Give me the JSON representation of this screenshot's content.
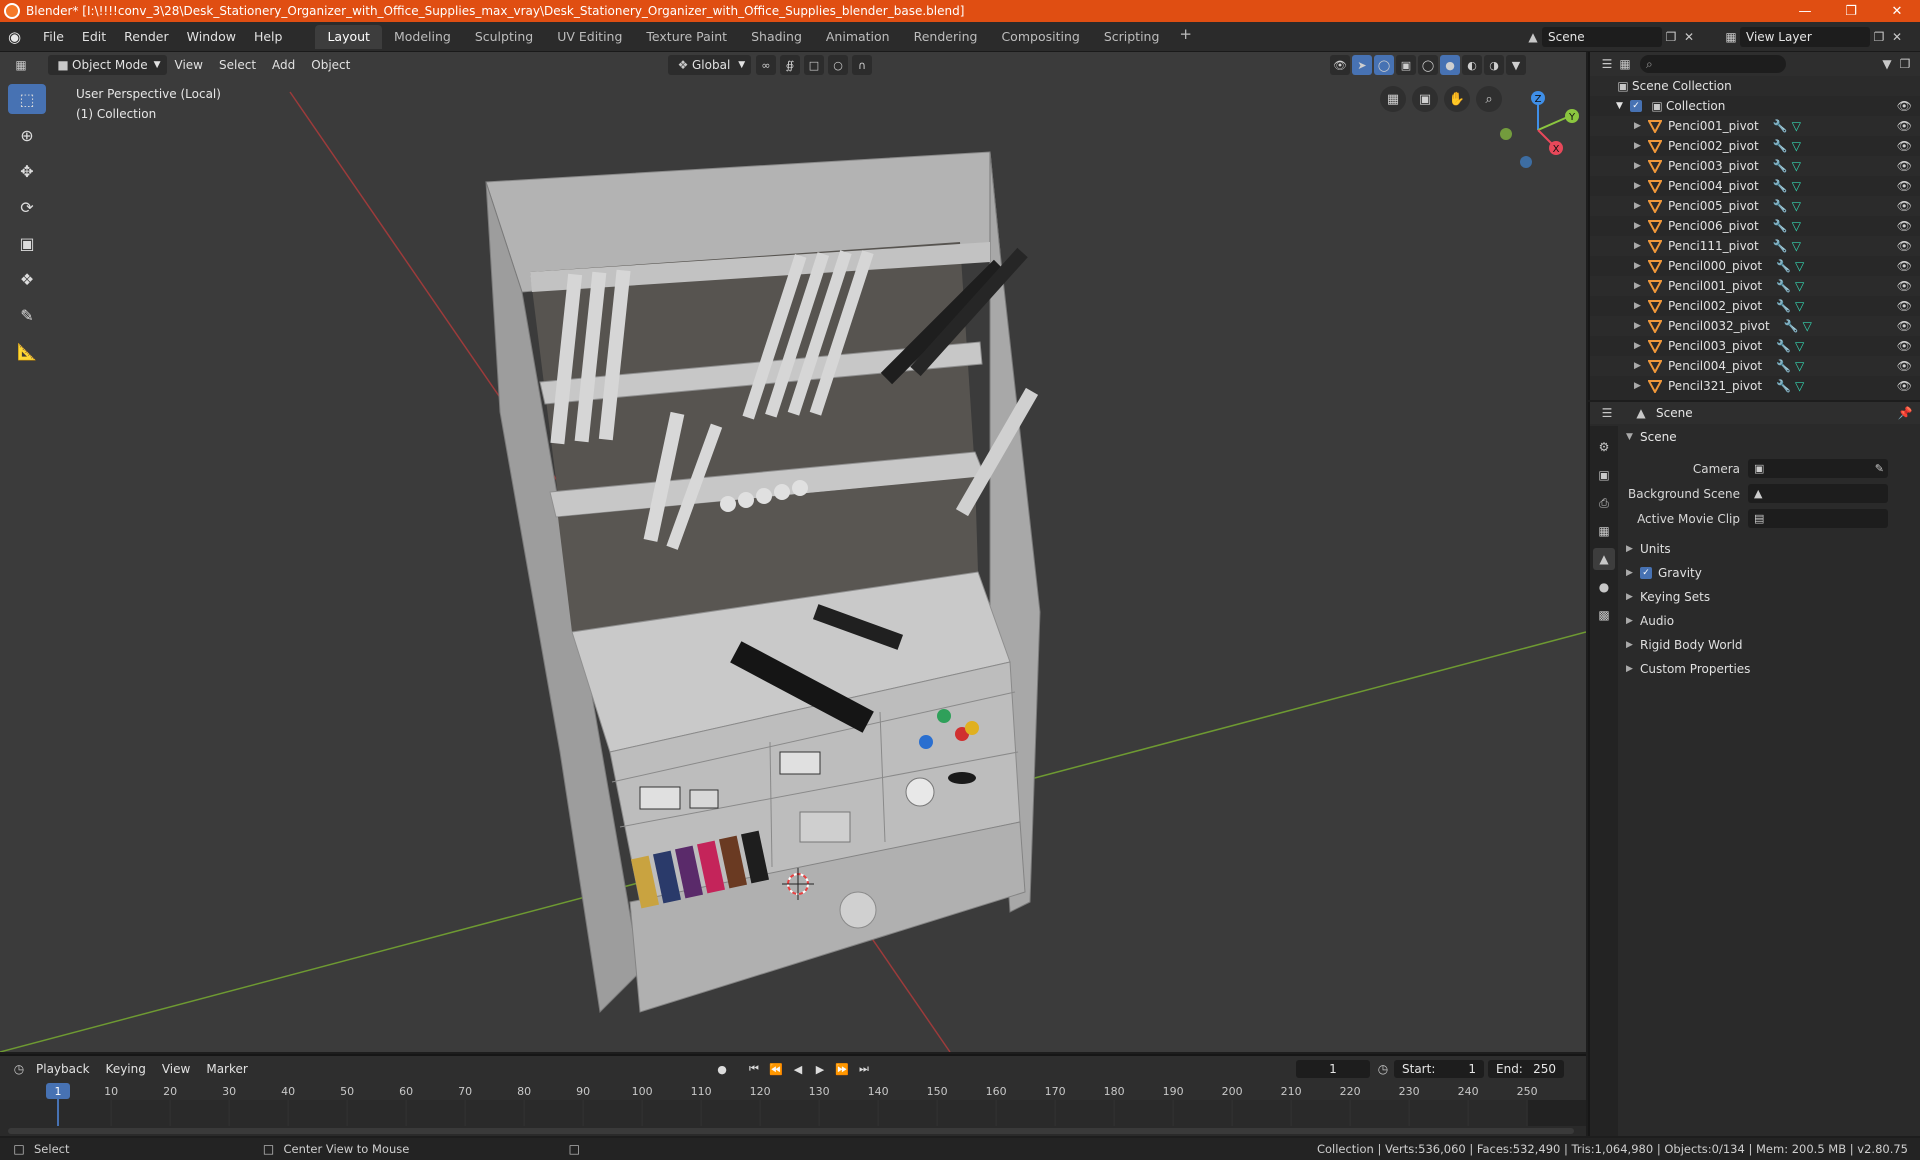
{
  "window": {
    "title": "Blender* [I:\\!!!!conv_3\\28\\Desk_Stationery_Organizer_with_Office_Supplies_max_vray\\Desk_Stationery_Organizer_with_Office_Supplies_blender_base.blend]"
  },
  "menubar": {
    "menus": [
      "File",
      "Edit",
      "Render",
      "Window",
      "Help"
    ],
    "workspaces": [
      "Layout",
      "Modeling",
      "Sculpting",
      "UV Editing",
      "Texture Paint",
      "Shading",
      "Animation",
      "Rendering",
      "Compositing",
      "Scripting"
    ],
    "active_workspace": "Layout",
    "scene_name": "Scene",
    "view_layer": "View Layer"
  },
  "viewport": {
    "mode": "Object Mode",
    "menus": [
      "View",
      "Select",
      "Add",
      "Object"
    ],
    "orientation": "Global",
    "info_line1": "User Perspective (Local)",
    "info_line2": "(1) Collection",
    "gizmo_axes": {
      "x": "X",
      "y": "Y",
      "z": "Z"
    }
  },
  "outliner": {
    "root": "Scene Collection",
    "collection": "Collection",
    "objects": [
      "Penci001_pivot",
      "Penci002_pivot",
      "Penci003_pivot",
      "Penci004_pivot",
      "Penci005_pivot",
      "Penci006_pivot",
      "Penci111_pivot",
      "Pencil000_pivot",
      "Pencil001_pivot",
      "Pencil002_pivot",
      "Pencil0032_pivot",
      "Pencil003_pivot",
      "Pencil004_pivot",
      "Pencil321_pivot"
    ]
  },
  "properties": {
    "header": "Scene",
    "panel": "Scene",
    "fields": [
      {
        "label": "Camera"
      },
      {
        "label": "Background Scene"
      },
      {
        "label": "Active Movie Clip"
      }
    ],
    "subpanels": [
      "Units",
      "Gravity",
      "Keying Sets",
      "Audio",
      "Rigid Body World",
      "Custom Properties"
    ]
  },
  "timeline": {
    "menus": [
      "Playback",
      "Keying",
      "View",
      "Marker"
    ],
    "current_frame": "1",
    "start_label": "Start:",
    "start_value": "1",
    "end_label": "End:",
    "end_value": "250",
    "ticks": [
      "1",
      "10",
      "20",
      "30",
      "40",
      "50",
      "60",
      "70",
      "80",
      "90",
      "100",
      "110",
      "120",
      "130",
      "140",
      "150",
      "160",
      "170",
      "180",
      "190",
      "200",
      "210",
      "220",
      "230",
      "240",
      "250"
    ]
  },
  "statusbar": {
    "select": "Select",
    "center_view": "Center View to Mouse",
    "stats": "Collection | Verts:536,060 | Faces:532,490 | Tris:1,064,980 | Objects:0/134 | Mem: 200.5 MB | v2.80.75"
  },
  "colors": {
    "title_bar": "#e04e12",
    "accent": "#4772b3",
    "viewport_bg": "#3b3b3b",
    "x_axis": "#e8485a",
    "y_axis": "#8bc63f",
    "z_axis": "#3f8fe8",
    "object_icon": "#f0983a"
  }
}
